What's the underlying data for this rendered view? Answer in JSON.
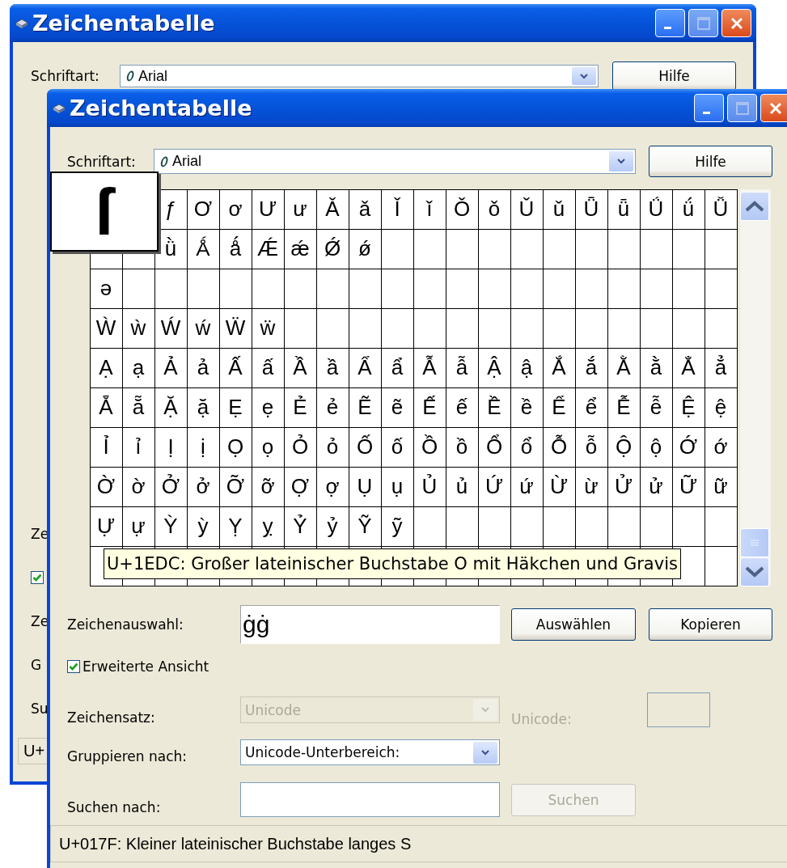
{
  "back_window": {
    "title": "Zeichentabelle",
    "font": {
      "label": "Schriftart:",
      "value": "Arial"
    },
    "help_button": {
      "label": "Hilfe"
    },
    "fragments": [
      {
        "kind": "text",
        "text": "Ze"
      },
      {
        "kind": "checkbox",
        "checked": true
      },
      {
        "kind": "text",
        "text": "Ze"
      },
      {
        "kind": "text",
        "text": "G"
      },
      {
        "kind": "text",
        "text": "Su"
      },
      {
        "kind": "status",
        "text": "U+"
      }
    ]
  },
  "front_window": {
    "title": "Zeichentabelle",
    "font": {
      "label": "Schriftart:",
      "value": "Arial"
    },
    "help_button": {
      "label": "Hilfe"
    },
    "grid": {
      "rows": [
        {
          "cells": [
            "",
            "",
            "ƒ",
            "Ơ",
            "ơ",
            "Ư",
            "ư",
            "Ǎ",
            "ǎ",
            "Ǐ",
            "ǐ",
            "Ǒ",
            "ǒ",
            "Ǔ",
            "ǔ",
            "Ǖ",
            "ǖ",
            "Ǘ",
            "ǘ",
            "Ǚ"
          ]
        },
        {
          "cells": [
            "",
            "",
            "ǜ",
            "Ǻ",
            "ǻ",
            "Ǽ",
            "ǽ",
            "Ǿ",
            "ǿ"
          ]
        },
        {
          "cells": [
            "ə"
          ]
        },
        {
          "cells": [
            "Ẁ",
            "ẁ",
            "Ẃ",
            "ẃ",
            "Ẅ",
            "ẅ"
          ]
        },
        {
          "cells": [
            "Ạ",
            "ạ",
            "Ả",
            "ả",
            "Ấ",
            "ấ",
            "Ầ",
            "ầ",
            "Ẩ",
            "ẩ",
            "Ẫ",
            "ẫ",
            "Ậ",
            "ậ",
            "Ắ",
            "ắ",
            "Ằ",
            "ằ",
            "Ẳ",
            "ẳ"
          ]
        },
        {
          "cells": [
            "Ẵ",
            "ẵ",
            "Ặ",
            "ặ",
            "Ẹ",
            "ẹ",
            "Ẻ",
            "ẻ",
            "Ẽ",
            "ẽ",
            "Ế",
            "ế",
            "Ề",
            "ề",
            "Ể",
            "ể",
            "Ễ",
            "ễ",
            "Ệ",
            "ệ"
          ]
        },
        {
          "cells": [
            "Ỉ",
            "ỉ",
            "Ị",
            "ị",
            "Ọ",
            "ọ",
            "Ỏ",
            "ỏ",
            "Ố",
            "ố",
            "Ồ",
            "ồ",
            "Ổ",
            "ổ",
            "Ỗ",
            "ỗ",
            "Ộ",
            "ộ",
            "Ớ",
            "ớ"
          ]
        },
        {
          "cells": [
            "Ờ",
            "ờ",
            "Ở",
            "ở",
            "Ỡ",
            "ỡ",
            "Ợ",
            "ợ",
            "Ụ",
            "ụ",
            "Ủ",
            "ủ",
            "Ứ",
            "ứ",
            "Ừ",
            "ừ",
            "Ử",
            "ử",
            "Ữ",
            "ữ"
          ]
        },
        {
          "cells": [
            "Ự",
            "ự",
            "Ỳ",
            "ỳ",
            "Ỵ",
            "ỵ",
            "Ỷ",
            "ỷ",
            "Ỹ",
            "ỹ"
          ]
        }
      ]
    },
    "magnifier": {
      "char": "ſ"
    },
    "tooltip": "U+1EDC: Großer lateinischer Buchstabe O mit Häkchen und Gravis",
    "selection": {
      "label": "Zeichenauswahl:",
      "value": "ġġ"
    },
    "select_button": {
      "label": "Auswählen"
    },
    "copy_button": {
      "label": "Kopieren"
    },
    "advanced_view": {
      "label": "Erweiterte Ansicht",
      "checked": true
    },
    "charset": {
      "label": "Zeichensatz:",
      "value": "Unicode",
      "disabled": true
    },
    "unicode": {
      "label": "Unicode:",
      "disabled": true
    },
    "group_by": {
      "label": "Gruppieren nach:",
      "value": "Unicode-Unterbereich:",
      "disabled": false
    },
    "search": {
      "label": "Suchen nach:"
    },
    "search_button": {
      "label": "Suchen",
      "disabled": true
    },
    "status_bar": "U+017F: Kleiner lateinischer Buchstabe langes S"
  }
}
